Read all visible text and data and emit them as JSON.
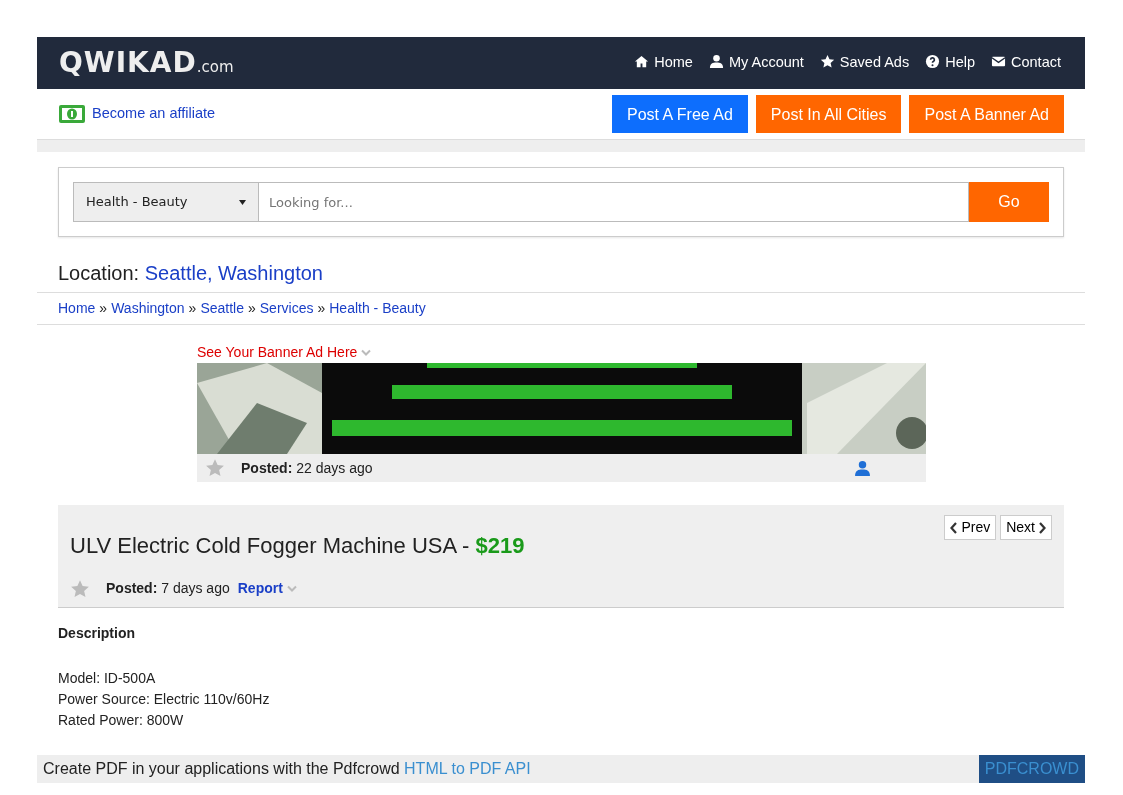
{
  "brand": {
    "name": "QWIKAD",
    "suffix": ".com"
  },
  "nav": [
    {
      "kind": "home",
      "label": "Home"
    },
    {
      "kind": "user",
      "label": "My Account"
    },
    {
      "kind": "star",
      "label": "Saved Ads"
    },
    {
      "kind": "help",
      "label": "Help"
    },
    {
      "kind": "mail",
      "label": "Contact"
    }
  ],
  "affiliate": "Become an affiliate",
  "post_buttons": [
    {
      "label": "Post A Free Ad",
      "color": "#0d6efd"
    },
    {
      "label": "Post In All Cities",
      "color": "#ff6600"
    },
    {
      "label": "Post A Banner Ad",
      "color": "#ff6600"
    }
  ],
  "search": {
    "category": "Health - Beauty",
    "placeholder": "Looking for...",
    "button": "Go"
  },
  "location": {
    "label": "Location:",
    "value": "Seattle, Washington"
  },
  "breadcrumb": [
    {
      "kind": "link",
      "text": "Home"
    },
    {
      "kind": "separator",
      "text": "»"
    },
    {
      "kind": "link",
      "text": "Washington"
    },
    {
      "kind": "separator",
      "text": "»"
    },
    {
      "kind": "link",
      "text": "Seattle"
    },
    {
      "kind": "separator",
      "text": "»"
    },
    {
      "kind": "link",
      "text": "Services"
    },
    {
      "kind": "separator",
      "text": "»"
    },
    {
      "kind": "link",
      "text": "Health - Beauty"
    }
  ],
  "banner": {
    "link": "See Your Banner Ad Here",
    "posted_label": "Posted:",
    "posted": "22 days ago"
  },
  "ad": {
    "title": "ULV Electric Cold Fogger Machine USA - ",
    "price": "$219",
    "prev": "Prev",
    "next": "Next",
    "posted_label": "Posted:",
    "posted": "7 days ago",
    "report": "Report"
  },
  "description": {
    "heading": "Description",
    "lines": [
      "Model: ID-500A",
      "Power Source: Electric 110v/60Hz",
      "Rated Power: 800W"
    ]
  },
  "pdf_bar": {
    "text": "Create PDF in your applications with the Pdfcrowd ",
    "link": "HTML to PDF API",
    "button": "PDFCROWD"
  }
}
